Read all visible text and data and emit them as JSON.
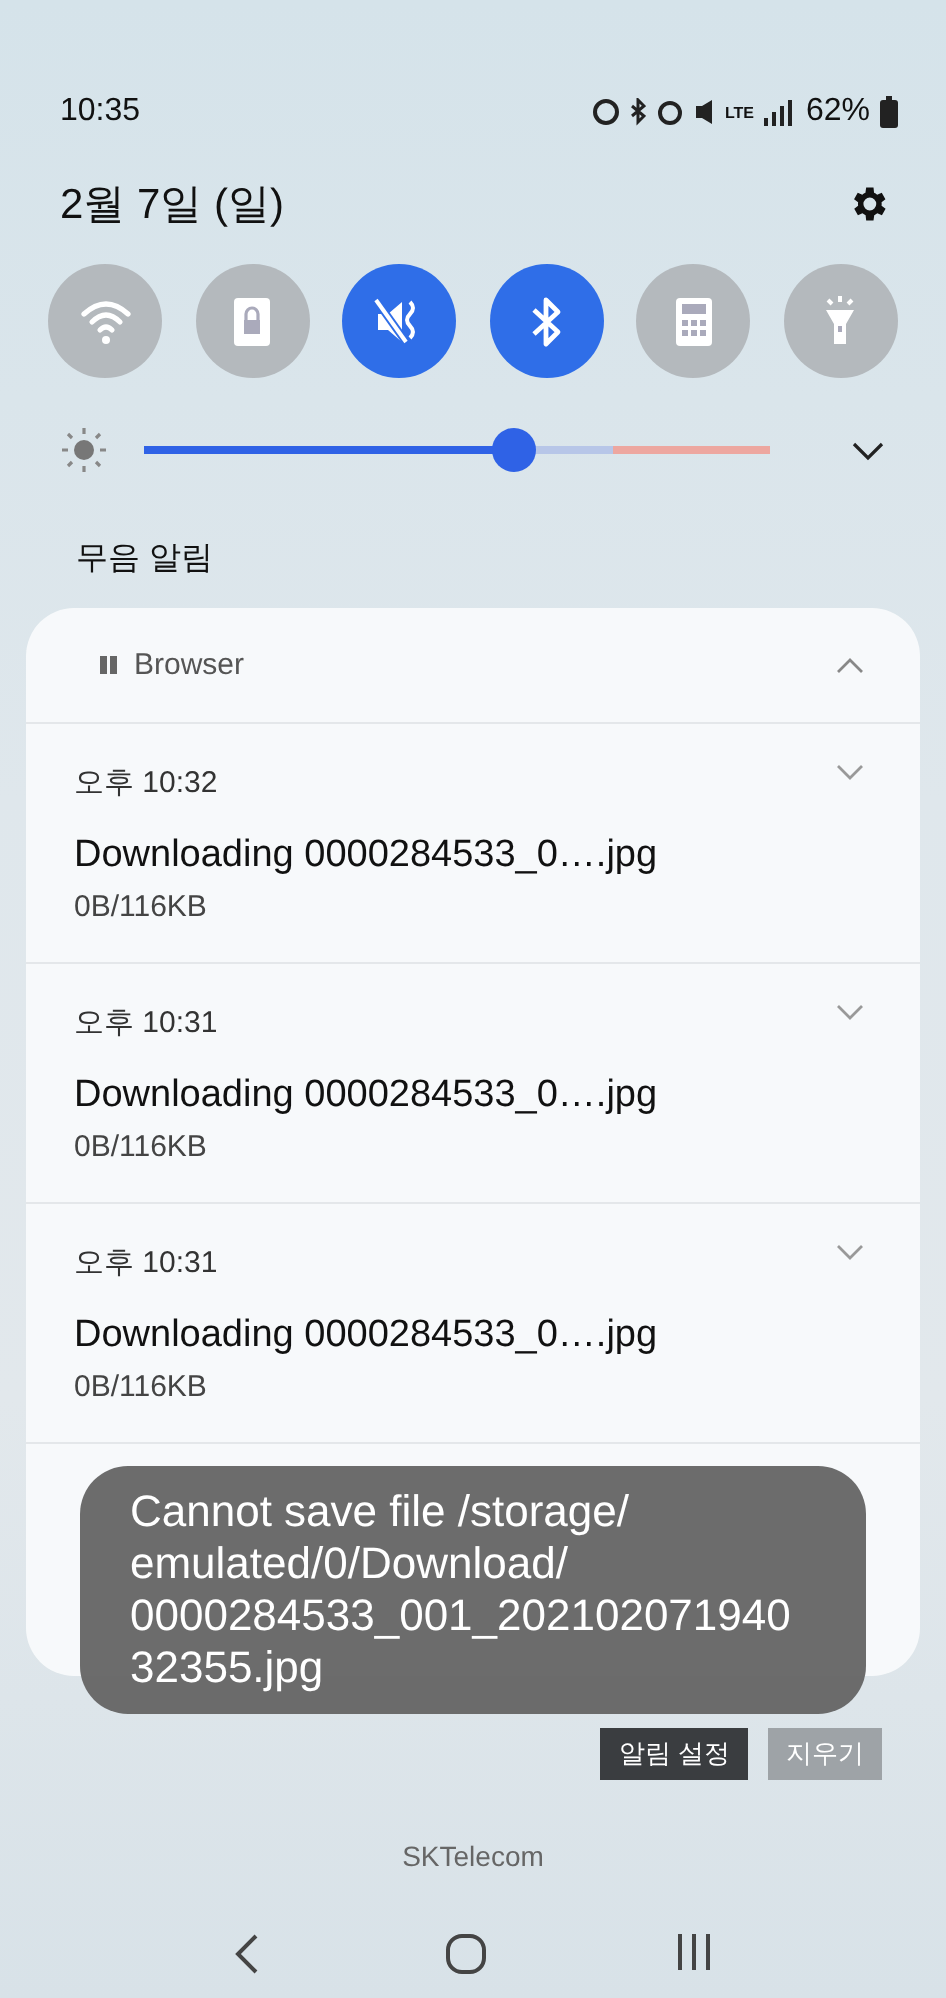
{
  "status_bar": {
    "time": "10:35",
    "battery_text": "62%",
    "network": "LTE"
  },
  "header": {
    "date": "2월 7일 (일)"
  },
  "quick_toggles": [
    {
      "kind": "wifi",
      "on": false
    },
    {
      "kind": "lock",
      "on": false
    },
    {
      "kind": "mute",
      "on": true
    },
    {
      "kind": "bluetooth",
      "on": true
    },
    {
      "kind": "calculator",
      "on": false
    },
    {
      "kind": "flashlight",
      "on": false
    }
  ],
  "brightness": {
    "level": 0.59
  },
  "section_label": "무음 알림",
  "notification_group": {
    "app": "Browser",
    "expanded": true,
    "items": [
      {
        "time": "오후 10:32",
        "title": "Downloading 0000284533_0….jpg",
        "progress": "0B/116KB"
      },
      {
        "time": "오후 10:31",
        "title": "Downloading 0000284533_0….jpg",
        "progress": "0B/116KB"
      },
      {
        "time": "오후 10:31",
        "title": "Downloading 0000284533_0….jpg",
        "progress": "0B/116KB"
      }
    ]
  },
  "footer_buttons": [
    "알림 설정",
    "지우기"
  ],
  "carrier": "SKTelecom",
  "toast": "Cannot save file /storage/emulated/0/Download/0000284533_001_20210207194032355.jpg"
}
